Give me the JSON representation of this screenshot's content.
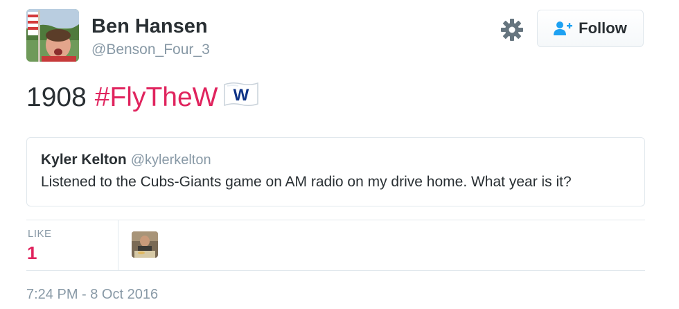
{
  "author": {
    "name": "Ben Hansen",
    "handle": "@Benson_Four_3"
  },
  "follow_button": {
    "label": "Follow",
    "icon": "add-user-icon"
  },
  "settings_icon": "gear-icon",
  "tweet": {
    "year": "1908",
    "hashtag": "#FlyTheW",
    "emoji": "w-flag-icon"
  },
  "quoted_tweet": {
    "name": "Kyler Kelton",
    "handle": "@kylerkelton",
    "text": "Listened to the Cubs-Giants game on AM radio on my drive home. What year is it?"
  },
  "stats": {
    "like_label": "LIKE",
    "like_count": "1"
  },
  "timestamp": "7:24 PM - 8 Oct 2016",
  "colors": {
    "hashtag": "#e0245e",
    "like": "#e0245e",
    "secondary_text": "#8899a6",
    "border": "#e1e8ed"
  }
}
